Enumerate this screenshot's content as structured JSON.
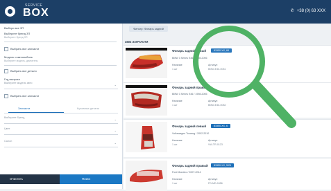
{
  "header": {
    "logo_top": "SERVICE",
    "logo_bottom": "BOX",
    "phone": "+38 (0) 63 XXX",
    "phone_icon": "phone-icon"
  },
  "sidebar": {
    "field1_label": "Выбери все ЗП",
    "field2_label": "Выберите бренд ЗП",
    "field2_placeholder": "Выберите бренд ЗП",
    "check1": "Выбрать все запчасти",
    "field3_label": "Модель и автомобиль",
    "field3_placeholder": "Выберите модель, двигатель",
    "check2": "Выбрать все детали",
    "select1_label": "Год выпуска",
    "select1_value": "Выберите модель авто",
    "check3": "Выбрать все запчасти",
    "tab_active": "Запчасти",
    "tab_inactive": "Кузовные детали",
    "select2_value": "Выберите бренд",
    "select3_value": "Цвет",
    "select4_value": "Салон",
    "reset_label": "Очистить",
    "search_label": "Поиск"
  },
  "main": {
    "filter_chip": "Фильтр: Фонарь задний",
    "results_title": "4502 ЗАПЧАСТИ"
  },
  "cards": [
    {
      "title": "Фонарь задний левый",
      "badge": "81550-XX, 84",
      "line": "BMW 3 Series E46 / 1998-2006",
      "lbl1": "Наличие",
      "val1": "1 шт",
      "lbl2": "Артикул",
      "val2": "BMW-E46-0081"
    },
    {
      "title": "Фонарь задний правый",
      "badge": "",
      "line": "BMW 3 Series E46 / 1998-2005",
      "lbl1": "Наличие",
      "val1": "1 шт",
      "lbl2": "Артикул",
      "val2": "BMW-E46-0082"
    },
    {
      "title": "Фонарь задний левый",
      "badge": "81550-XX, 6",
      "line": "Volkswagen Touareg / 2002-2010",
      "lbl1": "Наличие",
      "val1": "1 шт",
      "lbl2": "Артикул",
      "val2": "VW-TR-0123"
    },
    {
      "title": "Фонарь задний правый",
      "badge": "81550-XX, 5/26",
      "line": "Ford Mondeo / 2007-2014",
      "lbl1": "Наличие",
      "val1": "1 шт",
      "lbl2": "Артикул",
      "val2": "FD-MD-0456"
    }
  ],
  "overlay": {
    "magnifier_icon": "magnifier-icon",
    "color": "#4fb265"
  }
}
